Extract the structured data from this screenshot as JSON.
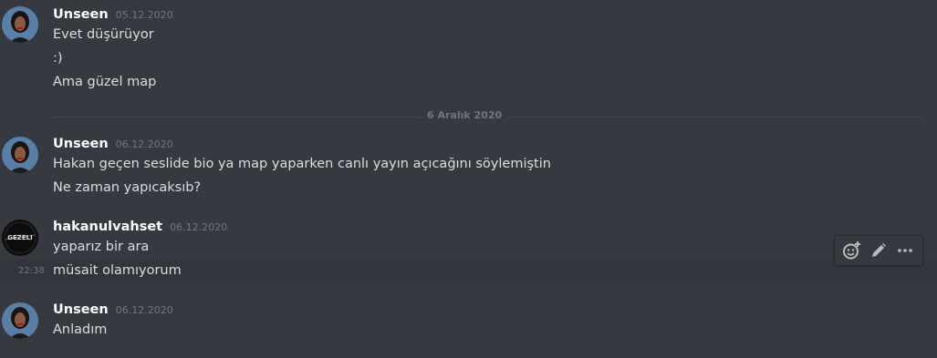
{
  "groups": [
    {
      "username": "Unseen",
      "timestamp": "05.12.2020",
      "messages": [
        "Evet düşürüyor",
        ":)",
        "Ama güzel map"
      ]
    },
    {
      "username": "Unseen",
      "timestamp": "06.12.2020",
      "messages": [
        "Hakan geçen seslide bio ya map yaparken canlı yayın açıcağını söylemiştin",
        "Ne zaman yapıcaksıb?"
      ]
    },
    {
      "username": "hakanulvahset",
      "timestamp": "06.12.2020",
      "messages": [
        "yaparız bir ara",
        "müsait olamıyorum"
      ],
      "hover_time": "22:38",
      "avatar_text": "GEZELI"
    },
    {
      "username": "Unseen",
      "timestamp": "06.12.2020",
      "messages": [
        "Anladım"
      ]
    }
  ],
  "date_divider": "6 Aralık 2020",
  "toolbar": {
    "icons": [
      "add-reaction-icon",
      "edit-icon",
      "more-icon"
    ]
  },
  "colors": {
    "background": "#36393f",
    "username": "#ffffff",
    "message": "#dcddde",
    "muted": "#72767d"
  }
}
